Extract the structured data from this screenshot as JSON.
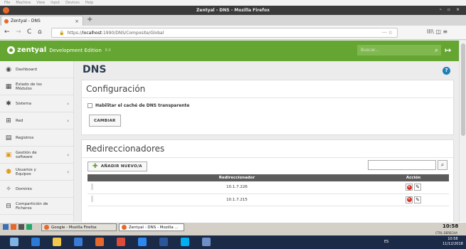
{
  "vm_menu": [
    "File",
    "Machine",
    "View",
    "Input",
    "Devices",
    "Help"
  ],
  "window_title": "Zentyal - DNS - Mozilla Firefox",
  "tab": {
    "label": "Zentyal - DNS",
    "close": "×",
    "new": "+"
  },
  "nav": {
    "back": "←",
    "forward": "→",
    "reload": "C",
    "home": "⌂",
    "url_prefix": "https://",
    "url_host": "localhost",
    "url_path": ":1990/DNS/Composite/Global",
    "url_menu": "···",
    "right_icons": "III\\ ◫ ≡"
  },
  "header": {
    "brand": "zentyal",
    "edition": "Development Edition",
    "version": "6.0",
    "search_placeholder": "Buscar...",
    "search_icon": "search-icon",
    "logout_icon": "logout-icon"
  },
  "sidebar": {
    "items": [
      {
        "label": "Dashboard",
        "icon": "◉",
        "arrow": ""
      },
      {
        "label": "Estado de los Módulos",
        "icon": "▦",
        "arrow": ""
      },
      {
        "label": "Sistema",
        "icon": "✱",
        "arrow": "‹"
      },
      {
        "label": "Red",
        "icon": "⊞",
        "arrow": "‹"
      },
      {
        "label": "Registros",
        "icon": "▤",
        "arrow": ""
      },
      {
        "label": "Gestión de software",
        "icon": "▣",
        "arrow": "‹"
      },
      {
        "label": "Usuarios y Equipos",
        "icon": "⚉",
        "arrow": "‹"
      },
      {
        "label": "Dominio",
        "icon": "✧",
        "arrow": ""
      },
      {
        "label": "Compartición de Ficheros",
        "icon": "⊟",
        "arrow": ""
      }
    ]
  },
  "page": {
    "title": "DNS",
    "help": "?",
    "config": {
      "title": "Configuración",
      "checkbox_label": "Habilitar el caché de DNS transparente",
      "submit": "CAMBIAR"
    },
    "forwarders": {
      "title": "Redireccionadores",
      "add_button": "AÑADIR NUEVO/A",
      "search_placeholder": "",
      "columns": [
        "Redireccionador",
        "Acción"
      ],
      "rows": [
        {
          "ip": "10.1.7.226"
        },
        {
          "ip": "10.1.7.215"
        }
      ]
    }
  },
  "taskbar": {
    "tasks": [
      "Google - Mozilla Firefox",
      "Zentyal - DNS - Mozilla ..."
    ],
    "clock": "10:58",
    "tray_text": "CTRL DERECHA"
  },
  "host_taskbar": {
    "time": "10:58",
    "date": "11/12/2018",
    "lang": "ES"
  }
}
